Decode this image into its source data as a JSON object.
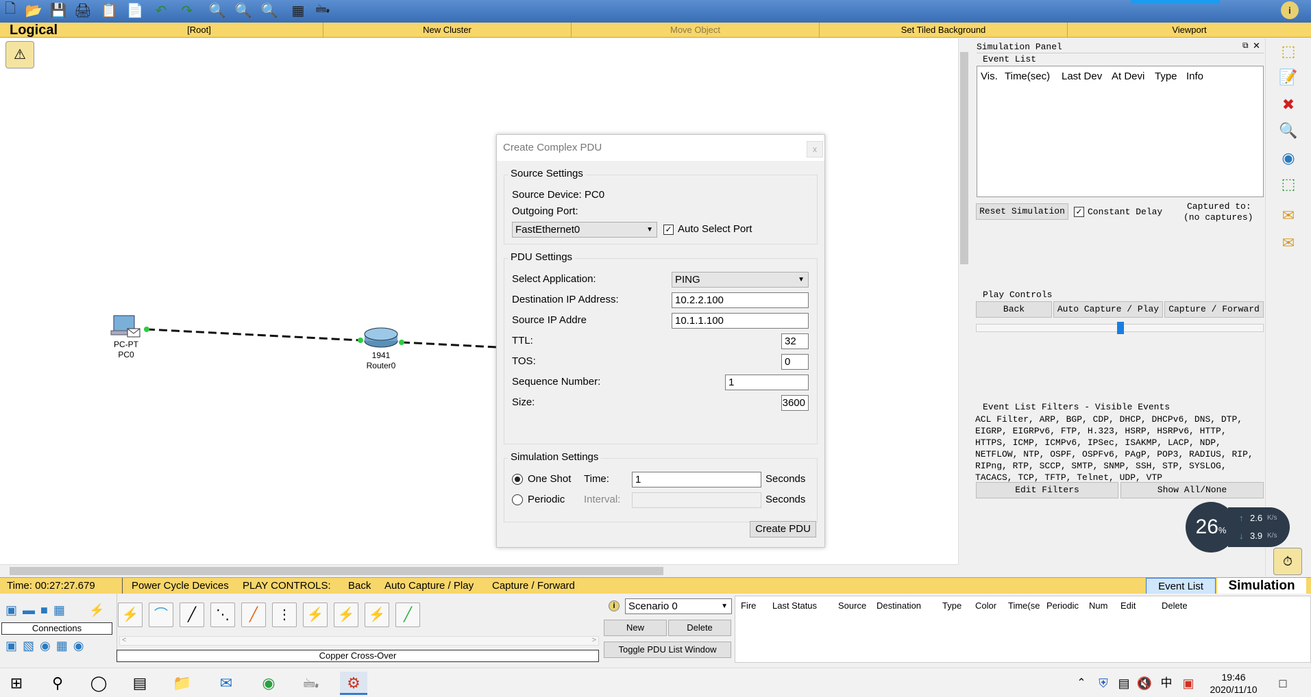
{
  "toolbar": {
    "icons": [
      "new-icon",
      "open-icon",
      "save-icon",
      "print-icon",
      "wizard-icon",
      "copy-icon",
      "undo-icon",
      "redo-icon",
      "zoom-in-icon",
      "zoom-reset-icon",
      "zoom-out-icon",
      "palette-icon",
      "custom-device-icon"
    ]
  },
  "logical_bar": {
    "title": "Logical",
    "items": [
      "[Root]",
      "New Cluster",
      "Move Object",
      "Set Tiled Background",
      "Viewport"
    ]
  },
  "topology": {
    "pc": {
      "type": "PC-PT",
      "name": "PC0"
    },
    "router": {
      "type": "1941",
      "name": "Router0"
    }
  },
  "dialog": {
    "title": "Create Complex PDU",
    "close": "x",
    "source": {
      "title": "Source Settings",
      "device_label": "Source Device: PC0",
      "port_label": "Outgoing Port:",
      "port_value": "FastEthernet0",
      "auto_select": "Auto Select Port"
    },
    "pdu": {
      "title": "PDU Settings",
      "app_label": "Select Application:",
      "app_value": "PING",
      "dest_label": "Destination IP Address:",
      "dest_value": "10.2.2.100",
      "src_label": "Source IP Addre",
      "src_value": "10.1.1.100",
      "ttl_label": "TTL:",
      "ttl_value": "32",
      "tos_label": "TOS:",
      "tos_value": "0",
      "seq_label": "Sequence Number:",
      "seq_value": "1",
      "size_label": "Size:",
      "size_value": "3600"
    },
    "sim": {
      "title": "Simulation Settings",
      "oneshot": "One Shot",
      "time_label": "Time:",
      "time_value": "1",
      "seconds": "Seconds",
      "periodic": "Periodic",
      "interval_label": "Interval:",
      "interval_value": "",
      "seconds2": "Seconds"
    },
    "create_button": "Create PDU"
  },
  "sim_panel": {
    "title": "Simulation Panel",
    "event_list_label": "Event List",
    "columns": [
      "Vis.",
      "Time(sec)",
      "Last Dev",
      "At Devi",
      "Type",
      "Info"
    ],
    "reset": "Reset Simulation",
    "constant_delay": "Constant Delay",
    "captured_to": "Captured to:",
    "no_captures": "(no captures)",
    "play_controls": "Play Controls",
    "back": "Back",
    "auto_capture": "Auto Capture / Play",
    "capture_forward": "Capture / Forward",
    "filters_title": "Event List Filters - Visible Events",
    "filters_lines": [
      "ACL Filter, ARP, BGP, CDP, DHCP, DHCPv6, DNS, DTP,",
      "EIGRP, EIGRPv6, FTP, H.323, HSRP, HSRPv6, HTTP,",
      "HTTPS, ICMP, ICMPv6, IPSec, ISAKMP, LACP, NDP,",
      "NETFLOW, NTP, OSPF, OSPFv6, PAgP, POP3, RADIUS, RIP,",
      "RIPng, RTP, SCCP, SMTP, SNMP, SSH, STP, SYSLOG,",
      "TACACS, TCP, TFTP, Telnet, UDP, VTP"
    ],
    "edit_filters": "Edit Filters",
    "show_all": "Show All/None"
  },
  "net_monitor": {
    "percent": "26",
    "up": "2.6",
    "down": "3.9",
    "unit": "K/s"
  },
  "status_bar": {
    "time": "Time: 00:27:27.679",
    "power": "Power Cycle Devices",
    "play_label": "PLAY CONTROLS:",
    "back": "Back",
    "auto": "Auto Capture / Play",
    "forward": "Capture / Forward",
    "event_list": "Event List",
    "simulation": "Simulation"
  },
  "bottom": {
    "connections": "Connections",
    "selected_tool": "Copper Cross-Over",
    "scenario": "Scenario 0",
    "new": "New",
    "delete": "Delete",
    "toggle": "Toggle PDU List Window",
    "pdu_columns": [
      "Fire",
      "Last Status",
      "Source",
      "Destination",
      "Type",
      "Color",
      "Time(se",
      "Periodic",
      "Num",
      "Edit",
      "Delete"
    ]
  },
  "taskbar": {
    "time": "19:46",
    "date": "2020/11/10",
    "ime": "中"
  }
}
